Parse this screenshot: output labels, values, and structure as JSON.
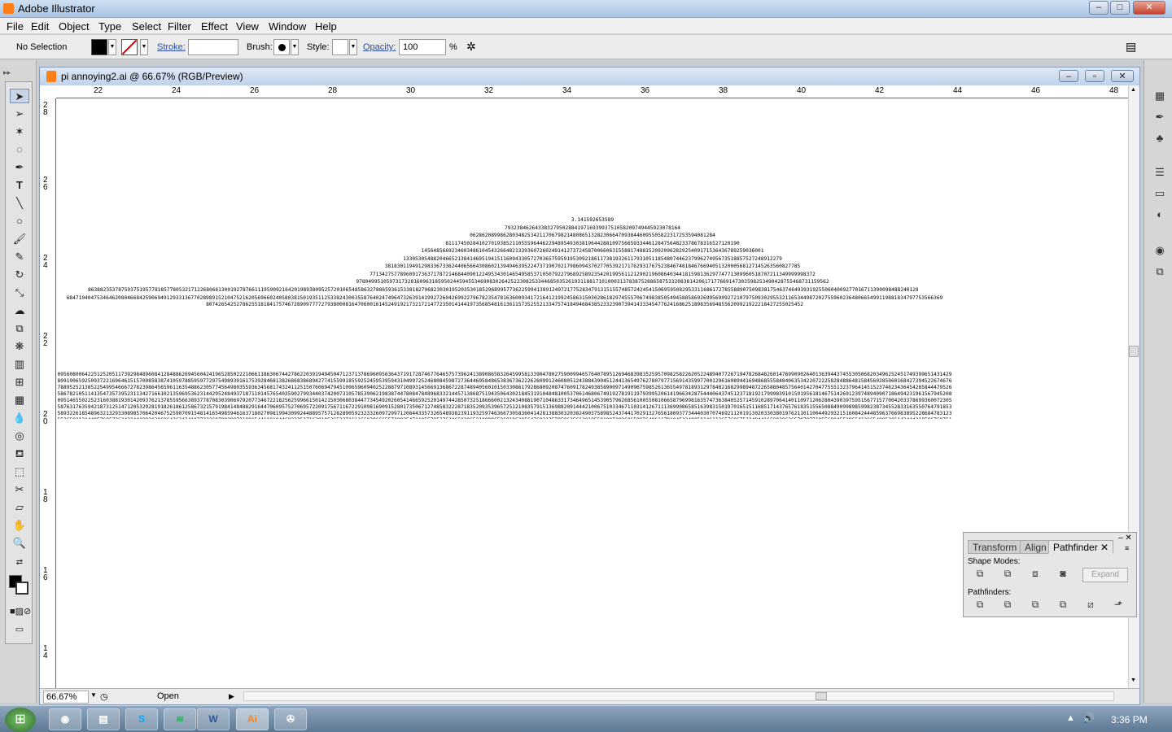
{
  "app": {
    "title": "Adobe Illustrator"
  },
  "menu": [
    "File",
    "Edit",
    "Object",
    "Type",
    "Select",
    "Filter",
    "Effect",
    "View",
    "Window",
    "Help"
  ],
  "control": {
    "selection": "No Selection",
    "stroke_label": "Stroke:",
    "brush_label": "Brush:",
    "style_label": "Style:",
    "opacity_label": "Opacity:",
    "opacity_value": "100",
    "percent": "%"
  },
  "document": {
    "title": "pi annoying2.ai @ 66.67% (RGB/Preview)",
    "zoom": "66.67%",
    "status": "Open",
    "h_ruler": [
      "22",
      "24",
      "26",
      "28",
      "30",
      "32",
      "34",
      "36",
      "38",
      "40",
      "42",
      "44",
      "46",
      "48"
    ],
    "v_ruler": [
      "2 8",
      "2 6",
      "2 4",
      "2 2",
      "2 0",
      "1 8",
      "1 6",
      "1 4"
    ],
    "pi_rows": [
      "3.141592653589",
      "7932384626433832795028841971693993751058209749445923078164",
      "062862089986280348253421170679821480865132823066470938446095505822317253594081284",
      "8111745028410270193852110555964462294895493038196442881097566593344612847564823378678316527120190",
      "14564856692346034861045432664821339360726024914127372458700660631558817488152092096282925409171536436789259036001",
      "13305305488204665213841469519415116094330572703657595919530921861173819326117931051185480744623799627495673518857527248912279",
      "38183011949129833673362440656643086021394946395224737190702179860943702770539217176293176752384674818467669405132000568127145263560827785",
      "771342757789609173637178721468440901224953430146549585371050792279689258923542019956112129021960864034418159813629774771309960518707211349999998372",
      "978049951059731732816096318595024459455346908302642522308253344685035261931188171010003137838752886587533208381420617177669147303598253490428755468731159562",
      "86388235378759375195778185778053217122680661300192787661119590921642019893809525720106548586327886593615338182796823030195203530185296899577362259941389124972177528347913151557485724245415069595082953311686172785588907509838175463746493931925506040092770167113900984882401285836160356370766010471018194295559619894676783744944825537977472",
      "684710404753464620804668425906949129331367702898915210475216205696602405803815019351125338243003558764024749647326391419927260426992279678235478163600934172164121992458631503028618297455570674983850549458858692699569092721079750930295532116534498720275596023648066549911988183479775356636980742654252786255181841757467289097777279380008164706001614524919217321721477235014144197356854816136115735255213347574184946843852332390739414333454776241686251898356948556209921922218427255025452",
      "0956080064225125205117392984896084128488626945604241965285022210661186306744278622039194945047123713786960956364371917287467764657573962413890865832645995813390478027590099465764078951269468398352595709825822620522489407726719478268482601476990902640136394437455305068203496252451749399651431429809190659250937221696461515709858387410597885959772975498930161753928468138268683868942774155991855925245953959431049972524680845987273644695848653836736222626099124608051243884390451244136549762780797715691435997700129616089441694868555848406353422072225828488648158456028506016842739452267467678895252138522549954666727823986456596116354886230577456498035593634568174324112515076069479451096596094025228879710893145669136867228748940560101503308617928680920874760917824938589009714909675985261365549781893129784821682998948722658804857564014270477555132379641451523746234364542858444795265867821051141354735739523113427166102135969536231442952484937187110145765403590279934403742007310578539062198387447808478489683321445713868751943506430218453191048481005370614680674919278191197939952061419663428754440643745123718192179998391015919561814675142691239748940907186494231961567945208095146550225231603881930142093762137855956638937787083039069792077346722182562599661501421503068038447734549202605414665925201497442850732518666002132434088190710486331734649651453905796268561005508106658796998163574736384052571459102897064140110971206280439039759515677157700420337869936007230558763176359421873125147120532928191826186125867321579198414848829164470609575270695722091756711672291098169091528017350671274858322287183520935396572512108357915136988209144421006751033467110314126711136990865851639831501970165151168517143765761835155650884909989859982387345528331635507647918535893226185489632132933089857064204675259070915481416549859461637180270981994309924488957571282890592323326097299712084433573265489382391193259746366730583604142813883032038249037589852437441702913276561809377344403070746921120191302033038019762110110044929321516084244485963766983895228684783123552658213144957685726243344189303968642624341077322697802807318915441101044682325271620105265227211166039666557309254711055785376346682065310989652691862056476931257058635662018558100729360659876486117910453348850346113657686753249441668039626579787718556084552965412665408530614344431858676975145661406800700237877659134401712749470420562230538994561314071127000407854733269939081454664645880797270826683063432858785698305235808933065757406795457163775254202114955761581400250126228594130216471550979259230990796547376125517656751357517829666454779174501129961489030463994713296210734043751895735961458901938971311179042978285647503203198691514028708085990480109412147221317947647772622414254854540332157185306142288137585043063321751829798662237172159160771669254748738986654949450114654062843366393790039769265672146385306736096571209180763832716641627488880078692560290228472104031721186082041900042296617119637792133757511495950156604963186294726547364252308177036751590673502350728354056704038674351362222477158915049530984448933309634087807693259939780541934144737744184263129860809988868741326047215695162396586457302163159819319516735381297416772947867242292465436680098067692823828068996400482435403701416314965897940924323789690706977942236250822168895738379862300159377647165122893578601588161755782973523344604281512627203734314653197777416031990665541876397929334419521541341899485444734567383162499341913181480927777103863877343177207545654532207770921201905166096280490926360197598828161332316663652861932668633606273567630354477628035045077723554710585954870279081435624014517180624643626794561275318134078330336254232783944975382437205835311477119926063813346776879695970309833913077109870408591337464144282277263465947047458784778720192771528073176790770715721344473060570073349243693113835049316312840425121925651798069411352801314701304781643788518529092854520116583934196562134914341595625865865570552690496520985803385072242648293972858478316305777756068887644624824685792603953527734803048029005876075825104747091643961362676044925627420420832085661190625454337213153595845068772460290161876679524061634252257719542916299193064553779914037340432875262888963995879475729174642635745525407909145135711136941091193932519107602082520261879853188770584297259167781314969900901921169717372784768472686084900337702424291651300500516832336435038951702989392233451722013812806965011784408745196012122859937162313017114448464090389064495444006198690754851602632750529834918740786680881833851022833450850486082503930213321971551843063545500766828294930413776552793975175461395398468339363830474611996653858153842056853386218672523340283087112328278921250771262946322956398989893582116745627010218356462201349671518819097303811980049734072396103685406643193950979019069963955245300545058068550195673022921913933918568034490398205955100226353536192041994745538593810234395544959778377902374216172711172364343543947822181852862408514006660443325888569867054315470696574745855033232334210730154594051655379068662733379958511562578432298827372319898757141595781119635833005940873068121602876496286744604774649159950549737425626901049037781986835938146574126804925648798556145372347867330390468838343634655379498641927056387293174872332083760112302991136793862708943879936201629515413371424892830722012690147546684765357616477379467520049075715552781965362132392640616013635815590742202020318727760527721900556148425551879253034351398442532234157623361064250639049750086562710953591946589751413103482276930624743536325691607815478181152843667957061108615331504452127473924544945423682886061340841486377670096120715124914043027253860764823634143346235189757664521641376796903149501910857598442391986291642193994907236234646844117394032659184044378051333894525742399508296591228508555821572503107125701266830240292952522011872676756220415420516184163484756516999811614101002996078386909291603028840026910414079288621507842451670908700069928212066041837180653556725253256753286129104248776182582976515795984703562226293486003415872298053498965022629174878820273420922224533985626476691490556284250391275771028402799806636582548892648802545661017296702664076559042909945681506526530537182941270336931378517860904070866711496558343434769338578171138645587367812301458768712660348913259562009"
    ]
  },
  "pathfinder": {
    "tabs": [
      "Transform",
      "Align",
      "Pathfinder"
    ],
    "shape_modes_label": "Shape Modes:",
    "pathfinders_label": "Pathfinders:",
    "expand_label": "Expand"
  },
  "taskbar": {
    "time": "3:36 PM",
    "ai_label": "Ai",
    "word_label": "W",
    "skype_label": "S"
  },
  "tool_icons": [
    "select-icon",
    "direct-select-icon",
    "magic-wand-icon",
    "lasso-icon",
    "pen-icon",
    "type-icon",
    "line-icon",
    "ellipse-icon",
    "paintbrush-icon",
    "pencil-icon",
    "rotate-icon",
    "scale-icon",
    "warp-icon",
    "free-transform-icon",
    "symbol-sprayer-icon",
    "graph-icon",
    "mesh-icon",
    "gradient-icon",
    "eyedropper-icon",
    "blend-icon",
    "live-paint-icon",
    "live-paint-select-icon",
    "slice-icon",
    "eraser-icon",
    "hand-icon",
    "zoom-icon"
  ]
}
